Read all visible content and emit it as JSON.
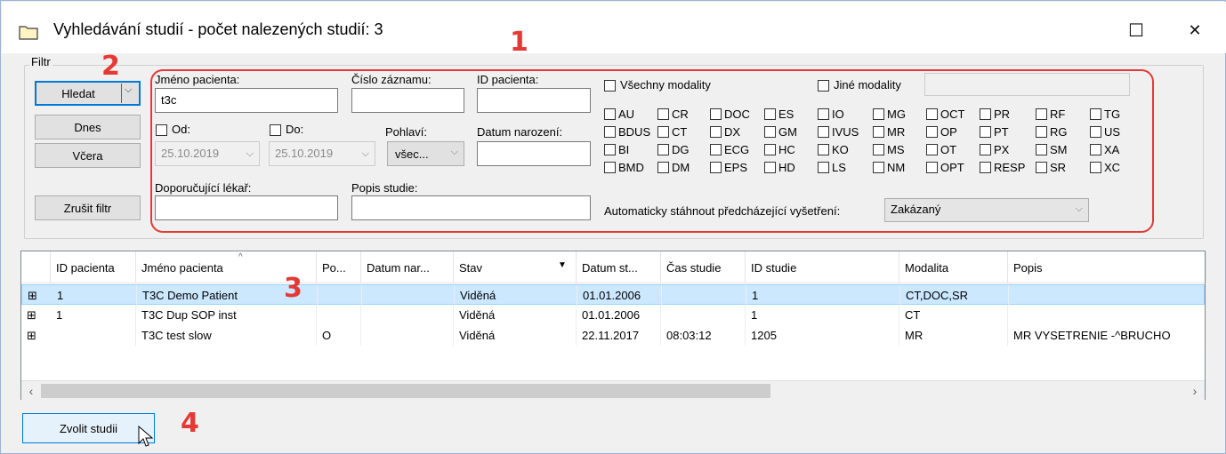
{
  "window": {
    "title": "Vyhledávání studií - počet nalezených studií: 3",
    "maximize_glyph": "☐",
    "close_glyph": "✕"
  },
  "filter": {
    "group_label": "Filtr",
    "search_button": "Hledat",
    "today_button": "Dnes",
    "yesterday_button": "Včera",
    "clear_button": "Zrušit filtr",
    "patient_name_label": "Jméno pacienta:",
    "patient_name_value": "t3c",
    "record_number_label": "Číslo záznamu:",
    "record_number_value": "",
    "patient_id_label": "ID pacienta:",
    "patient_id_value": "",
    "from_label": "Od:",
    "from_value": "25.10.2019",
    "to_label": "Do:",
    "to_value": "25.10.2019",
    "gender_label": "Pohlaví:",
    "gender_value": "všec...",
    "birth_date_label": "Datum narození:",
    "birth_date_value": "",
    "referring_doctor_label": "Doporučující lékař:",
    "referring_doctor_value": "",
    "study_desc_label": "Popis studie:",
    "study_desc_value": "",
    "all_modalities_label": "Všechny modality",
    "other_modalities_label": "Jiné modality",
    "auto_download_label": "Automaticky stáhnout předcházející vyšetření:",
    "auto_download_value": "Zakázaný",
    "modality_rows": [
      [
        "AU",
        "CR",
        "DOC",
        "ES",
        "IO",
        "MG",
        "OCT",
        "PR",
        "RF",
        "TG"
      ],
      [
        "BDUS",
        "CT",
        "DX",
        "GM",
        "IVUS",
        "MR",
        "OP",
        "PT",
        "RG",
        "US"
      ],
      [
        "BI",
        "DG",
        "ECG",
        "HC",
        "KO",
        "MS",
        "OT",
        "PX",
        "SM",
        "XA"
      ],
      [
        "BMD",
        "DM",
        "EPS",
        "HD",
        "LS",
        "NM",
        "OPT",
        "RESP",
        "SR",
        "XC"
      ]
    ]
  },
  "grid": {
    "columns": [
      "",
      "ID pacienta",
      "Jméno pacienta",
      "Po...",
      "Datum nar...",
      "Stav",
      "Datum st...",
      "Čas studie",
      "ID studie",
      "Modalita",
      "Popis"
    ],
    "rows": [
      [
        "⊞",
        "1",
        "T3C Demo Patient",
        "",
        "",
        "Viděná",
        "01.01.2006",
        "",
        "1",
        "CT,DOC,SR",
        ""
      ],
      [
        "⊞",
        "1",
        "T3C Dup SOP inst",
        "",
        "",
        "Viděná",
        "01.01.2006",
        "",
        "1",
        "CT",
        ""
      ],
      [
        "⊞",
        "",
        "T3C test slow",
        "O",
        "",
        "Viděná",
        "22.11.2017",
        "08:03:12",
        "1205",
        "MR",
        "MR VYSETRENIE -^BRUCHO"
      ]
    ]
  },
  "footer": {
    "choose_study_button": "Zvolit studii"
  },
  "annotations": [
    "1",
    "2",
    "3",
    "4"
  ],
  "colors": {
    "annotation_red": "#e53935",
    "selection_blue": "#cce8ff",
    "accent": "#0078d7"
  }
}
